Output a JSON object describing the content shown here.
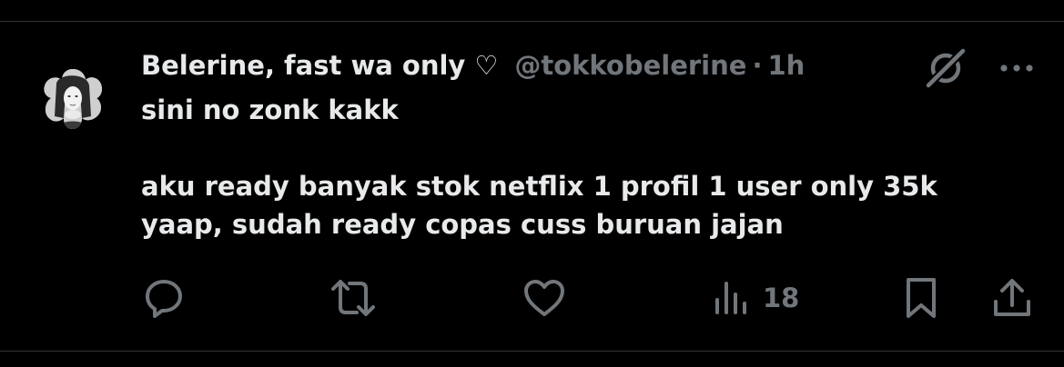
{
  "tweet": {
    "author": {
      "display_name": "Belerine, fast wa only",
      "heart_glyph": "♡",
      "handle": "@tokkobelerine",
      "separator": "·",
      "time": "1h"
    },
    "text_lines": [
      "sini no zonk kakk",
      "",
      "aku ready banyak stok netflix 1 profil 1 user only 35k",
      "yaap, sudah ready copas cuss buruan jajan"
    ],
    "actions": {
      "reply_icon": "reply-icon",
      "retweet_icon": "retweet-icon",
      "like_icon": "heart-icon",
      "views_icon": "views-icon",
      "views_count": "18",
      "bookmark_icon": "bookmark-icon",
      "share_icon": "share-icon"
    },
    "top_icons": {
      "grok": "grok-icon",
      "more": "more-icon"
    }
  },
  "colors": {
    "background": "#000000",
    "text": "#e7e9ea",
    "secondary": "#71767b",
    "divider": "#2f3336"
  }
}
